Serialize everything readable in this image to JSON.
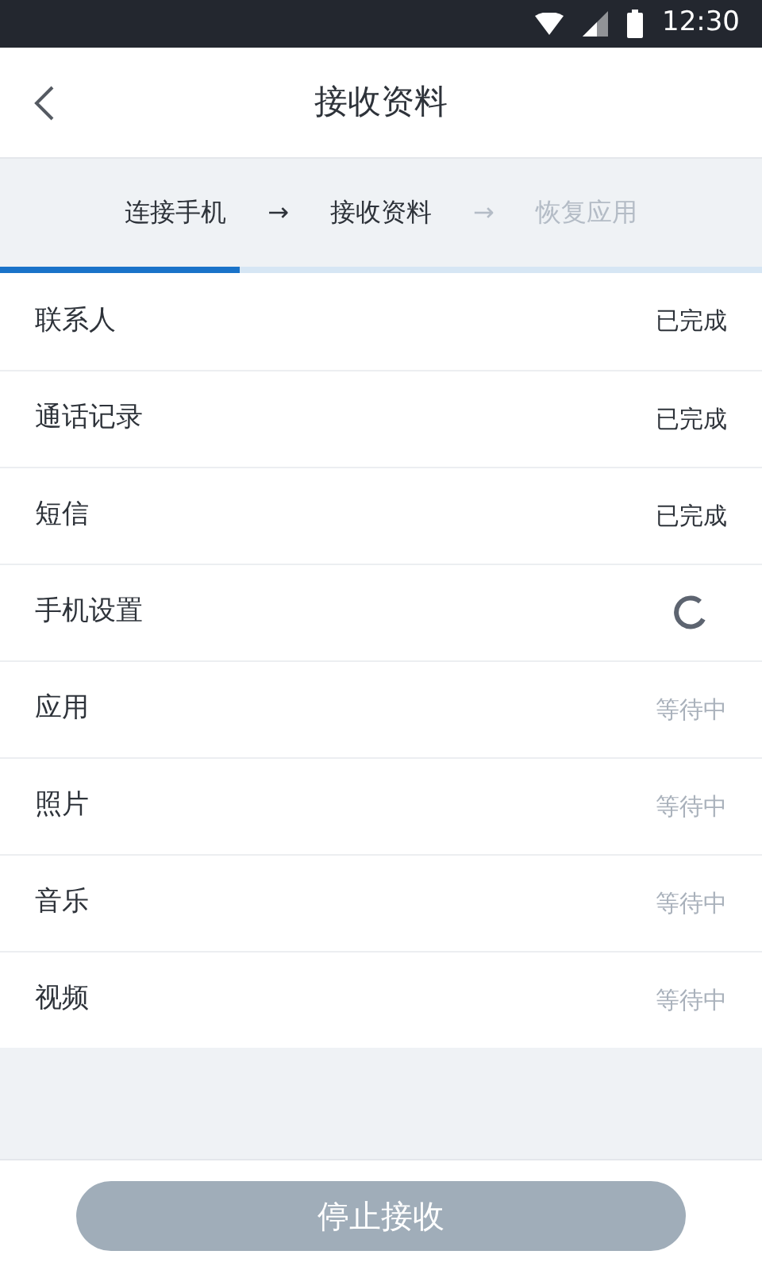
{
  "status_bar": {
    "time": "12:30"
  },
  "header": {
    "title": "接收资料"
  },
  "steps": [
    {
      "label": "连接手机",
      "active": true
    },
    {
      "label": "→",
      "active": true
    },
    {
      "label": "接收资料",
      "active": true
    },
    {
      "label": "→",
      "active": false
    },
    {
      "label": "恢复应用",
      "active": false
    }
  ],
  "progress": {
    "level": 0.315
  },
  "items": [
    {
      "name": "联系人",
      "kind": "done",
      "status": "已完成"
    },
    {
      "name": "通话记录",
      "kind": "done",
      "status": "已完成"
    },
    {
      "name": "短信",
      "kind": "done",
      "status": "已完成"
    },
    {
      "name": "手机设置",
      "kind": "loading"
    },
    {
      "name": "应用",
      "kind": "waiting",
      "status": "等待中"
    },
    {
      "name": "照片",
      "kind": "waiting",
      "status": "等待中"
    },
    {
      "name": "音乐",
      "kind": "waiting",
      "status": "等待中"
    },
    {
      "name": "视频",
      "kind": "waiting",
      "status": "等待中"
    }
  ],
  "footer": {
    "button": "停止接收",
    "disabled": true
  }
}
